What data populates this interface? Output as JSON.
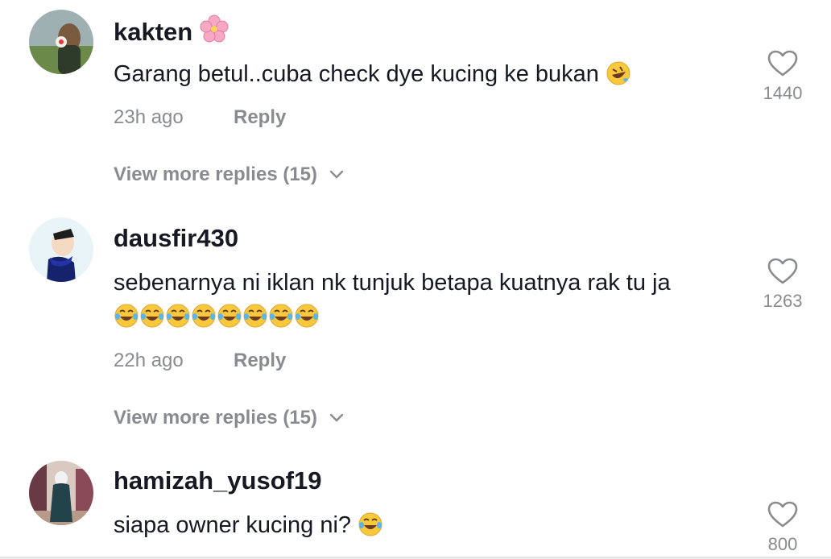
{
  "comments": [
    {
      "username": "kakten",
      "text": "Garang betul..cuba check dye kucing ke bukan",
      "time": "23h ago",
      "reply_label": "Reply",
      "view_more": "View more replies (15)",
      "likes": "1440",
      "username_emoji": "cherry-blossom-emoji",
      "text_emoji": "rofl-emoji"
    },
    {
      "username": "dausfir430",
      "text": "sebenarnya ni iklan nk tunjuk betapa kuatnya rak tu ja",
      "text_emoji": "joy-emoji",
      "text_emoji_count": 8,
      "time": "22h ago",
      "reply_label": "Reply",
      "view_more": "View more replies (15)",
      "likes": "1263"
    },
    {
      "username": "hamizah_yusof19",
      "text": "siapa owner kucing ni?",
      "text_emoji": "joy-emoji",
      "likes": "800"
    }
  ],
  "colors": {
    "primary_text": "#161823",
    "secondary_text": "#8a8b91"
  }
}
